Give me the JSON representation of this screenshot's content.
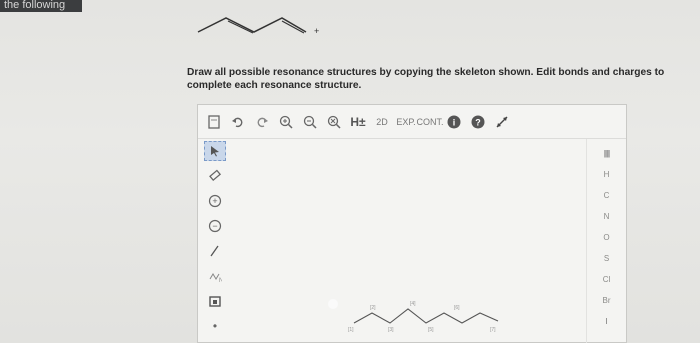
{
  "header_fragment": "the following",
  "question": "Draw all possible resonance structures by copying the skeleton shown. Edit bonds and charges to complete each resonance structure.",
  "skeleton_charge": "+",
  "toolbar": {
    "new_icon": "new-document-icon",
    "undo_icon": "undo-icon",
    "redo_icon": "redo-icon",
    "zoom_in_icon": "zoom-in-icon",
    "zoom_out_icon": "zoom-out-icon",
    "clear_icon": "clear-icon",
    "hydrogen": "H±",
    "twod": "2D",
    "exp": "EXP.",
    "cont": "CONT.",
    "info": "i",
    "help": "?",
    "expand_icon": "expand-icon"
  },
  "left_tools": {
    "tool_plus": "+",
    "tool_minus": "−",
    "chain": "N",
    "dot": "•"
  },
  "canvas": {
    "atom_labels": [
      "[1]",
      "[2]",
      "[3]",
      "[4]",
      "[5]",
      "[6]",
      "[7]"
    ]
  },
  "elements": {
    "periodic": "|||||",
    "list": [
      "H",
      "C",
      "N",
      "O",
      "S",
      "Cl",
      "Br"
    ],
    "more": "I"
  }
}
